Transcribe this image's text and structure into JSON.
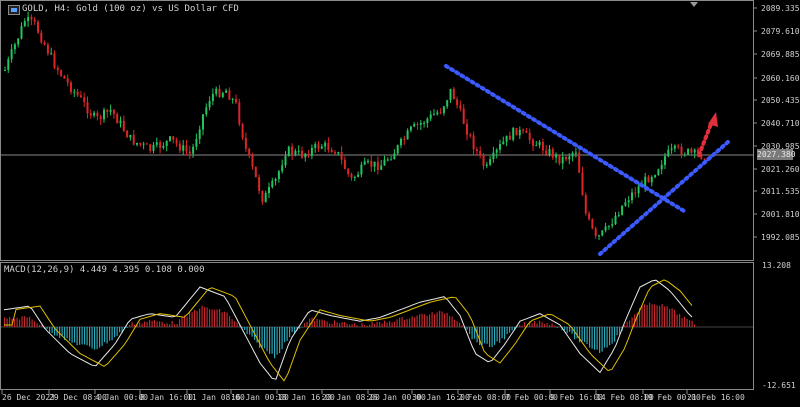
{
  "chart_title": "GOLD, H4:  Gold (100 oz) vs US Dollar CFD",
  "current_price": "2027.380",
  "price_axis": [
    "2089.335",
    "2079.610",
    "2069.885",
    "2060.160",
    "2050.435",
    "2040.710",
    "2030.985",
    "2021.260",
    "2011.535",
    "2001.810",
    "1992.085"
  ],
  "macd": {
    "label": "MACD(12,26,9) 4.449 4.395 0.108 0.000",
    "axis_max": "13.208",
    "axis_min": "-12.651"
  },
  "time_axis": [
    "26 Dec 2023",
    "29 Dec 08:00",
    "4 Jan 00:00",
    "8 Jan 16:00",
    "11 Jan 08:00",
    "16 Jan 00:00",
    "18 Jan 16:00",
    "23 Jan 08:00",
    "26 Jan 00:00",
    "30 Jan 16:00",
    "2 Feb 08:00",
    "7 Feb 00:00",
    "9 Feb 16:00",
    "14 Feb 08:00",
    "19 Feb 00:00",
    "21 Feb 16:00"
  ],
  "colors": {
    "bull": "#22c55e",
    "bear": "#dc2626",
    "trendline": "#3b5bff",
    "arrow": "#e0303b",
    "macd_line": "#e8e8e8",
    "signal_line": "#e0c000",
    "hist_pos": "#c0282d",
    "hist_neg": "#2aa8b8"
  }
}
